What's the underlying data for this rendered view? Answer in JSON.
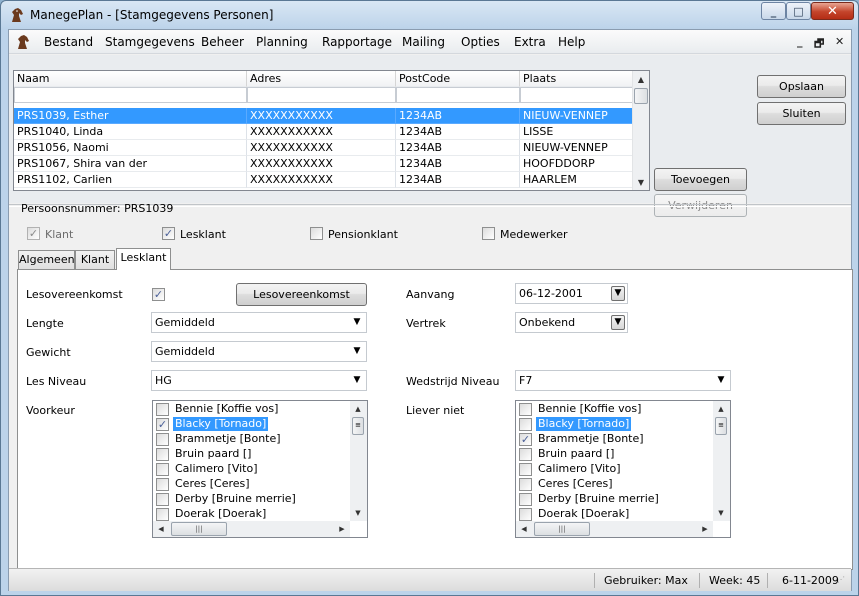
{
  "window": {
    "title": "ManegePlan - [Stamgegevens Personen]",
    "icon": "horse-icon",
    "controls": {
      "minimize": "_",
      "maximize": "□",
      "close": "✕"
    }
  },
  "menu": {
    "items": [
      "Bestand",
      "Stamgegevens",
      "Beheer",
      "Planning",
      "Rapportage",
      "Mailing",
      "Opties",
      "Extra",
      "Help"
    ],
    "mdi_controls": {
      "minimize": "_",
      "restore": "🗗",
      "close": "✕"
    }
  },
  "grid": {
    "columns": [
      "Naam",
      "Adres",
      "PostCode",
      "Plaats"
    ],
    "rows": [
      [
        "PRS1039, Esther",
        "XXXXXXXXXXX",
        "1234AB",
        "NIEUW-VENNEP"
      ],
      [
        "PRS1040, Linda",
        "XXXXXXXXXXX",
        "1234AB",
        "LISSE"
      ],
      [
        "PRS1056, Naomi",
        "XXXXXXXXXXX",
        "1234AB",
        "NIEUW-VENNEP"
      ],
      [
        "PRS1067, Shira van der",
        "XXXXXXXXXXX",
        "1234AB",
        "HOOFDDORP"
      ],
      [
        "PRS1102, Carlien",
        "XXXXXXXXXXX",
        "1234AB",
        "HAARLEM"
      ]
    ],
    "selected_row": 0
  },
  "buttons": {
    "opslaan": "Opslaan",
    "sluiten": "Sluiten",
    "toevoegen": "Toevoegen",
    "verwijderen": "Verwijderen",
    "lesovereenkomst": "Lesovereenkomst"
  },
  "person": {
    "number_label": "Persoonsnummer: PRS1039",
    "roles": [
      {
        "label": "Klant",
        "checked": true,
        "disabled": true
      },
      {
        "label": "Lesklant",
        "checked": true,
        "disabled": false
      },
      {
        "label": "Pensionklant",
        "checked": false,
        "disabled": false
      },
      {
        "label": "Medewerker",
        "checked": false,
        "disabled": false
      }
    ]
  },
  "tabs": [
    "Algemeen",
    "Klant",
    "Lesklant"
  ],
  "active_tab": "Lesklant",
  "form": {
    "lesovereenkomst_label": "Lesovereenkomst",
    "lesovereenkomst_checked": true,
    "lengte_label": "Lengte",
    "lengte_value": "Gemiddeld",
    "gewicht_label": "Gewicht",
    "gewicht_value": "Gemiddeld",
    "lesniveau_label": "Les Niveau",
    "lesniveau_value": "HG",
    "voorkeur_label": "Voorkeur",
    "aanvang_label": "Aanvang",
    "aanvang_value": "06-12-2001",
    "vertrek_label": "Vertrek",
    "vertrek_value": "Onbekend",
    "wedstrijdniveau_label": "Wedstrijd Niveau",
    "wedstrijdniveau_value": "F7",
    "lievernieet_label": "Liever niet"
  },
  "voorkeur_list": [
    {
      "label": "Bennie [Koffie vos]",
      "checked": false,
      "selected": false
    },
    {
      "label": "Blacky [Tornado]",
      "checked": true,
      "selected": true
    },
    {
      "label": "Brammetje [Bonte]",
      "checked": false,
      "selected": false
    },
    {
      "label": "Bruin paard []",
      "checked": false,
      "selected": false
    },
    {
      "label": "Calimero [Vito]",
      "checked": false,
      "selected": false
    },
    {
      "label": "Ceres [Ceres]",
      "checked": false,
      "selected": false
    },
    {
      "label": "Derby [Bruine merrie]",
      "checked": false,
      "selected": false
    },
    {
      "label": "Doerak [Doerak]",
      "checked": false,
      "selected": false
    }
  ],
  "lievernieet_list": [
    {
      "label": "Bennie [Koffie vos]",
      "checked": false,
      "selected": false
    },
    {
      "label": "Blacky [Tornado]",
      "checked": false,
      "selected": true
    },
    {
      "label": "Brammetje [Bonte]",
      "checked": true,
      "selected": false
    },
    {
      "label": "Bruin paard []",
      "checked": false,
      "selected": false
    },
    {
      "label": "Calimero [Vito]",
      "checked": false,
      "selected": false
    },
    {
      "label": "Ceres [Ceres]",
      "checked": false,
      "selected": false
    },
    {
      "label": "Derby [Bruine merrie]",
      "checked": false,
      "selected": false
    },
    {
      "label": "Doerak [Doerak]",
      "checked": false,
      "selected": false
    }
  ],
  "status": {
    "user": "Gebruiker: Max",
    "week": "Week: 45",
    "date": "6-11-2009"
  },
  "colors": {
    "selection": "#3399ff",
    "checkmark": "#4a5f97"
  }
}
